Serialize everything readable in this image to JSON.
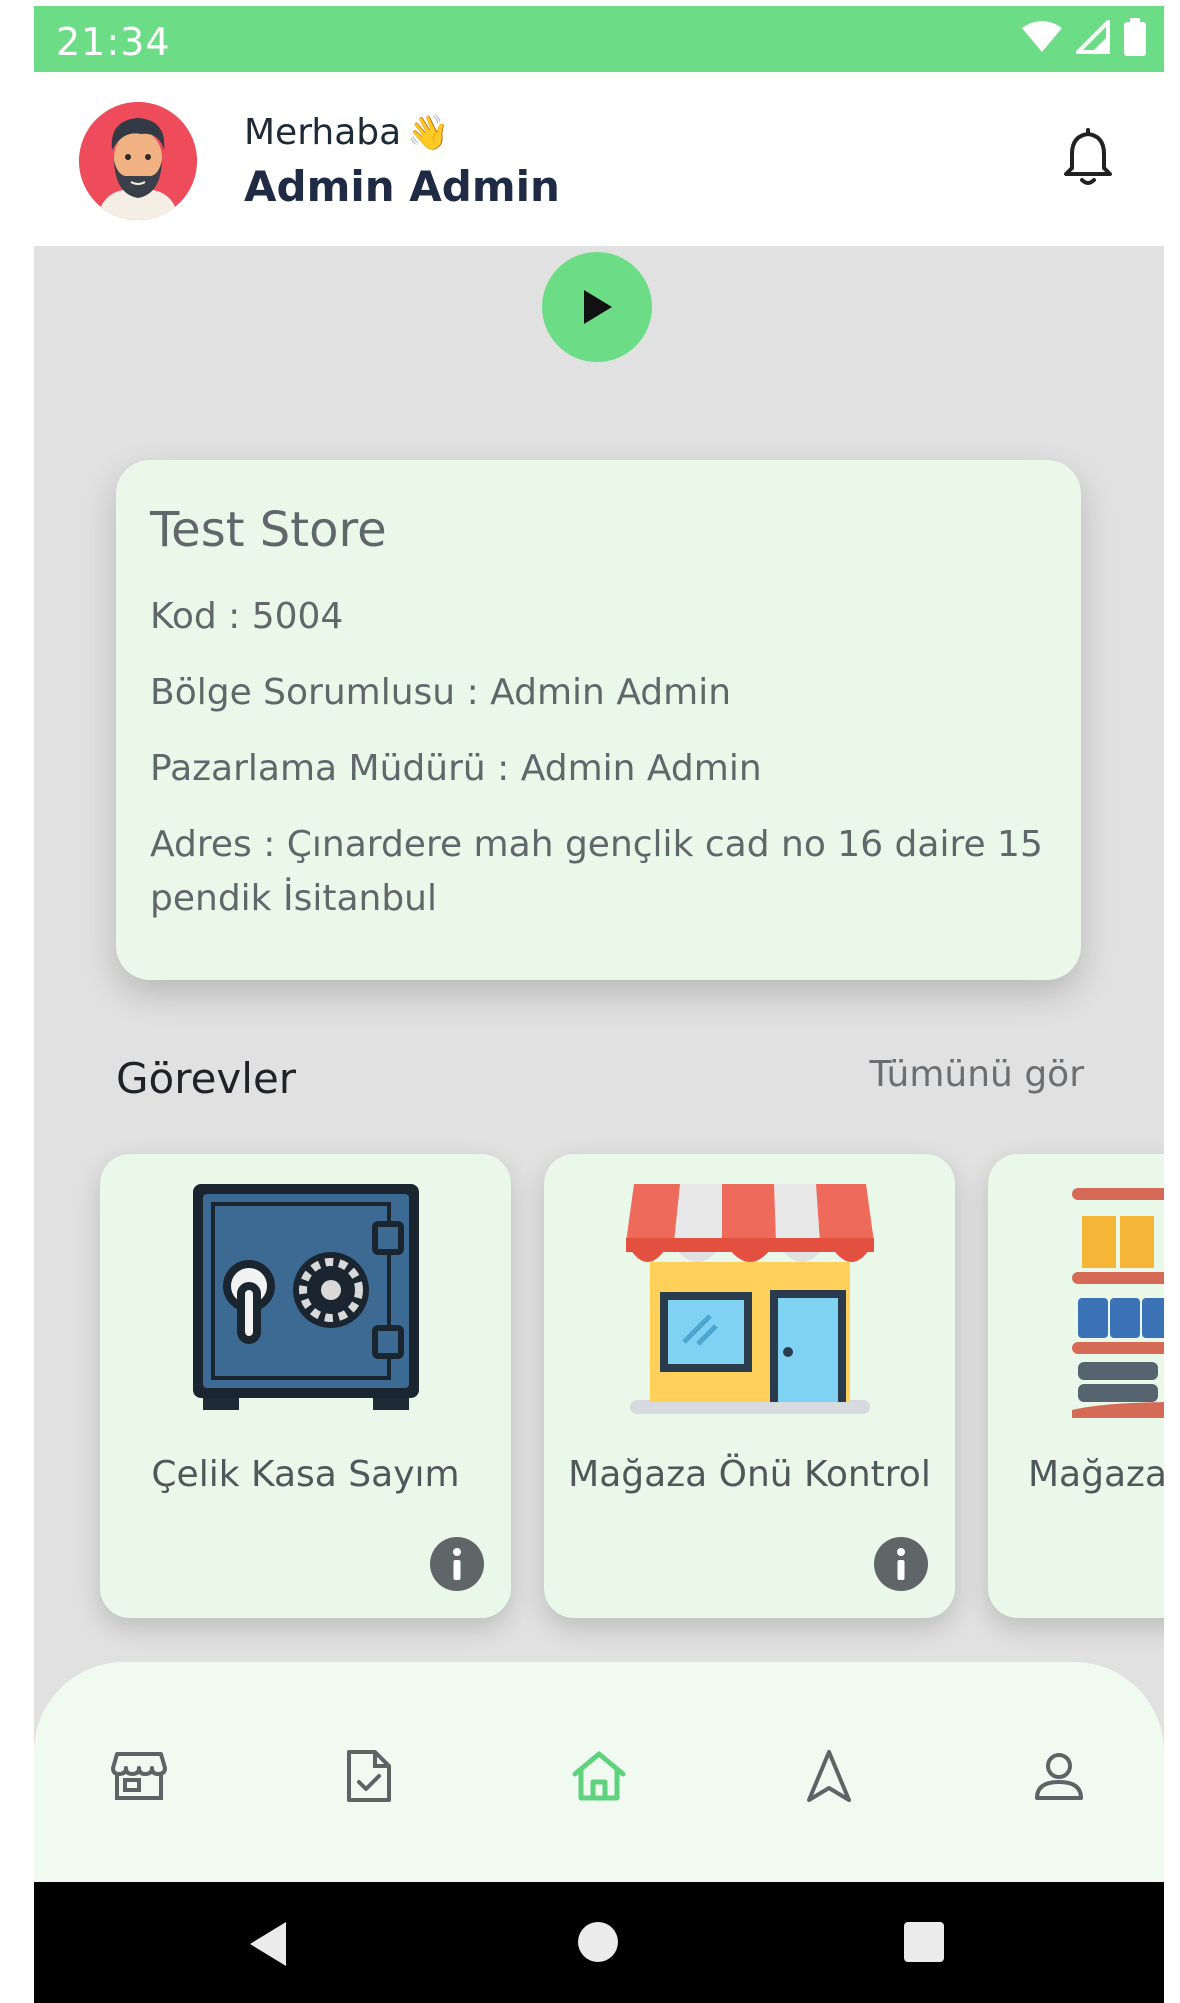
{
  "status_bar": {
    "time": "21:34",
    "icons": [
      "wifi-icon",
      "signal-icon",
      "battery-icon"
    ]
  },
  "header": {
    "greeting": "Merhaba",
    "greeting_emoji": "👋",
    "user_name": "Admin Admin"
  },
  "store": {
    "name": "Test Store",
    "code_line": "Kod : 5004",
    "region_manager_line": "Bölge Sorumlusu : Admin Admin",
    "marketing_manager_line": "Pazarlama Müdürü : Admin Admin",
    "address_line": "Adres : Çınardere mah gençlik cad no 16 daire 15 pendik İsitanbul"
  },
  "tasks": {
    "title": "Görevler",
    "see_all": "Tümünü gör",
    "items": [
      {
        "label": "Çelik Kasa Sayım",
        "icon": "safe-icon"
      },
      {
        "label": "Mağaza Önü Kontrol",
        "icon": "storefront-icon"
      },
      {
        "label": "Mağaza",
        "icon": "shelves-icon"
      }
    ]
  },
  "bottom_nav": {
    "items": [
      "store-icon",
      "task-check-icon",
      "home-icon",
      "navigation-icon",
      "profile-icon"
    ],
    "active": "home-icon"
  },
  "colors": {
    "accent": "#6ddc87",
    "card_bg": "#eaf8ea",
    "page_bg": "#e1e1e1",
    "nav_bg": "#f0faf1"
  }
}
